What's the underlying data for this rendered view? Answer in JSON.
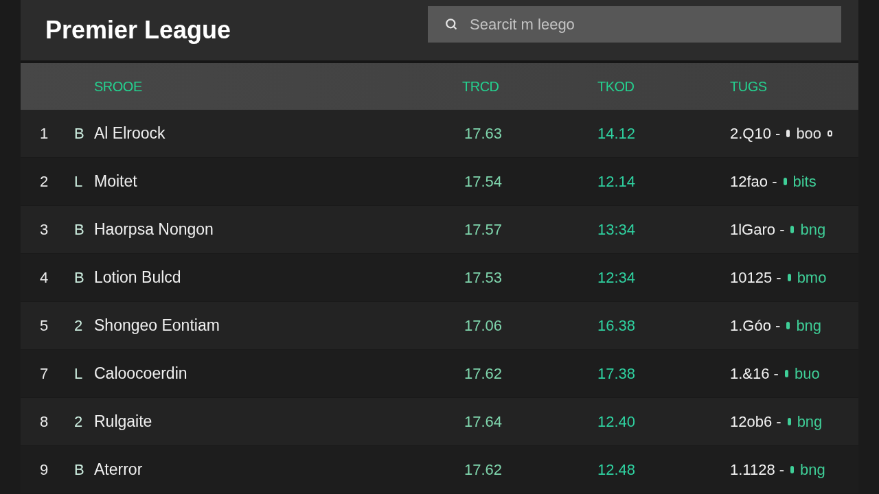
{
  "header": {
    "title": "Premier League",
    "search": {
      "placeholder": "Searcit m leego"
    }
  },
  "table": {
    "columns": [
      "SROOE",
      "TRCD",
      "TKOD",
      "TUGS"
    ],
    "rows": [
      {
        "rank": "1",
        "letter": "B",
        "name": "Al Elroock",
        "trcd": "17.63",
        "tkod": "14.12",
        "tugs": {
          "value": "2.Q10 -",
          "tag": "boo",
          "color": "#e6e6e6",
          "dot": true
        }
      },
      {
        "rank": "2",
        "letter": "L",
        "name": "Moitet",
        "trcd": "17.54",
        "tkod": "12.14",
        "tugs": {
          "value": "12fao -",
          "tag": "bits",
          "color": "#3fcf98",
          "dot": false
        }
      },
      {
        "rank": "3",
        "letter": "B",
        "name": "Haorpsa Nongon",
        "trcd": "17.57",
        "tkod": "13:34",
        "tugs": {
          "value": "1lGaro -",
          "tag": "bng",
          "color": "#3fcf98",
          "dot": false
        }
      },
      {
        "rank": "4",
        "letter": "B",
        "name": "Lotion Bulcd",
        "trcd": "17.53",
        "tkod": "12:34",
        "tugs": {
          "value": "10125 -",
          "tag": "bmo",
          "color": "#3fcf98",
          "dot": false
        }
      },
      {
        "rank": "5",
        "letter": "2",
        "name": "Shongeo Eontiam",
        "trcd": "17.06",
        "tkod": "16.38",
        "tugs": {
          "value": "1.Góo -",
          "tag": "bng",
          "color": "#3fcf98",
          "dot": false
        }
      },
      {
        "rank": "7",
        "letter": "L",
        "name": "Caloocoerdin",
        "trcd": "17.62",
        "tkod": "17.38",
        "tugs": {
          "value": "1.&16 -",
          "tag": "buo",
          "color": "#3fcf98",
          "dot": false
        }
      },
      {
        "rank": "8",
        "letter": "2",
        "name": "Rulgaite",
        "trcd": "17.64",
        "tkod": "12.40",
        "tugs": {
          "value": "12ob6 -",
          "tag": "bng",
          "color": "#3fcf98",
          "dot": false
        }
      },
      {
        "rank": "9",
        "letter": "B",
        "name": "Aterror",
        "trcd": "17.62",
        "tkod": "12.48",
        "tugs": {
          "value": "1.1128 -",
          "tag": "bng",
          "color": "#3fcf98",
          "dot": false
        }
      }
    ]
  }
}
